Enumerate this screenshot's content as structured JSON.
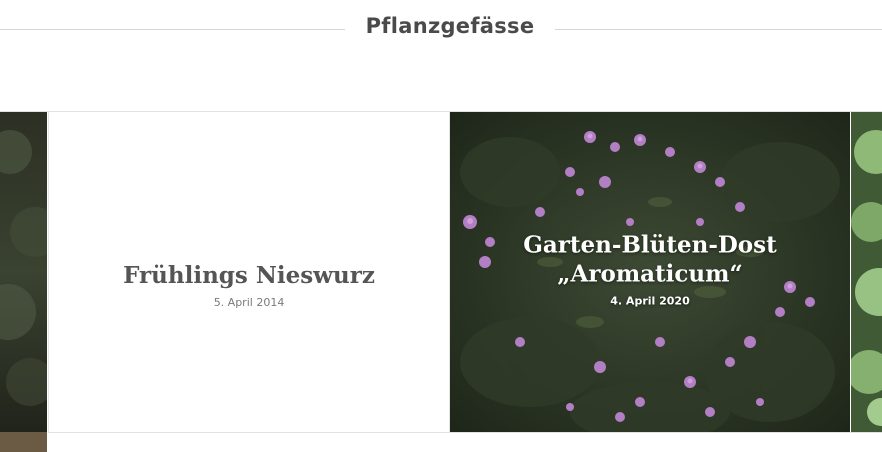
{
  "section": {
    "title": "Pflanzgefässe"
  },
  "tiles": [
    {
      "title": "Frühlings Nieswurz",
      "date": "5. April 2014"
    },
    {
      "title_line1": "Garten-Blüten-Dost",
      "title_line2": "„Aromaticum“",
      "date": "4. April 2020"
    }
  ],
  "colors": {
    "title_text": "#4a4a4a",
    "divider": "#d6d6d6",
    "photo_text": "#ffffff"
  }
}
